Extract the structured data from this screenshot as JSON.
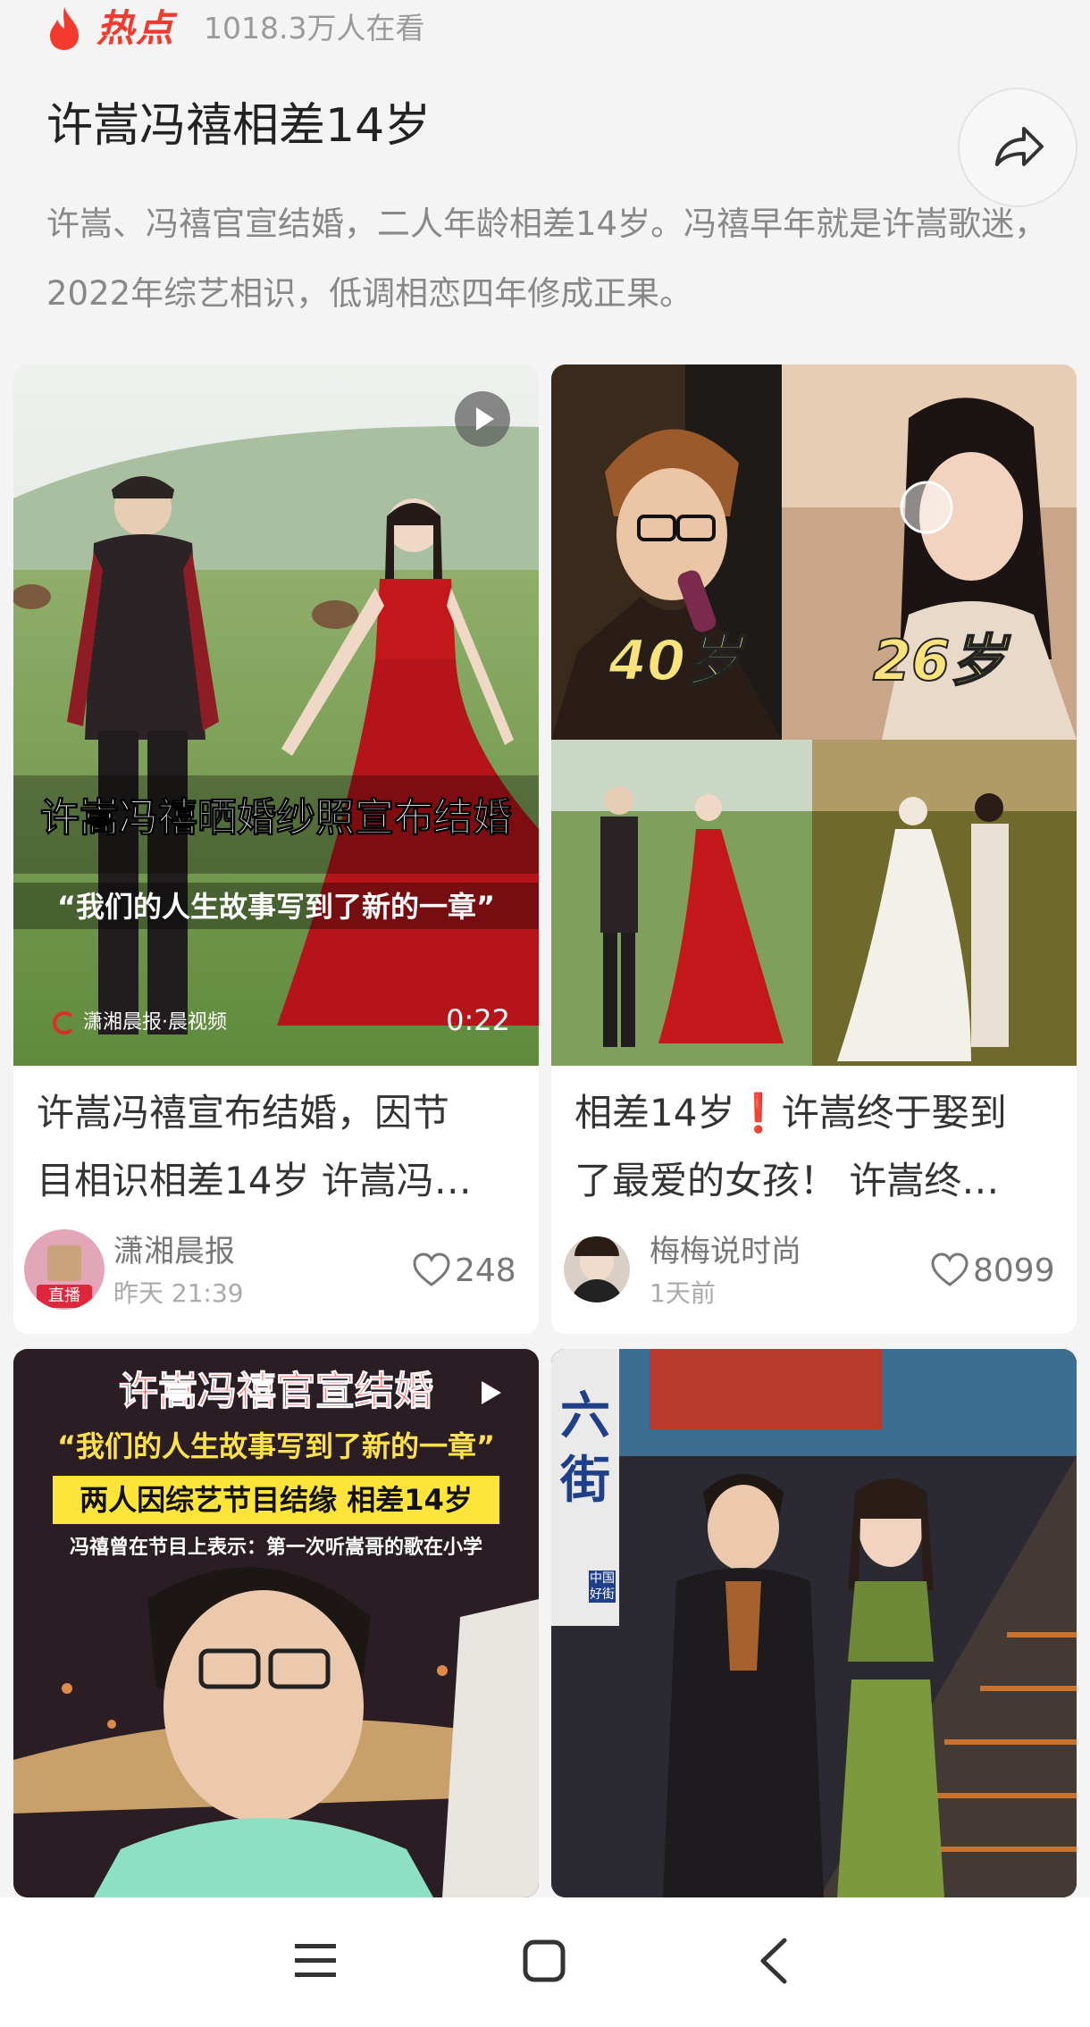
{
  "header": {
    "brand_label": "热点",
    "viewers": "1018.3万人在看",
    "title": "许嵩冯禧相差14岁",
    "description": "许嵩、冯禧官宣结婚，二人年龄相差14岁。冯禧早年就是许嵩歌迷，2022年综艺相识，低调相恋四年修成正果。"
  },
  "cards": [
    {
      "overlay_title": "许嵩冯禧晒婚纱照宣布结婚",
      "overlay_quote": "“我们的人生故事写到了新的一章”",
      "watermark": "潇湘晨报·晨视频",
      "duration": "0:22",
      "caption_line1": "许嵩冯禧宣布结婚，因节",
      "caption_line2": "目相识相差14岁 许嵩冯…",
      "author": "潇湘晨报",
      "avatar_badge": "直播",
      "time": "昨天 21:39",
      "likes": "248"
    },
    {
      "age_left": "40岁",
      "age_right": "26岁",
      "caption_line1": "相差14岁❗许嵩终于娶到",
      "caption_line2": "了最爱的女孩！ 许嵩终…",
      "author": "梅梅说时尚",
      "time": "1天前",
      "likes": "8099"
    },
    {
      "banner_title": "许嵩冯禧官宣结婚",
      "banner_quote": "“我们的人生故事写到了新的一章”",
      "banner_highlight": "两人因综艺节目结缘 相差14岁",
      "banner_sub": "冯禧曾在节目上表示：第一次听嵩哥的歌在小学"
    },
    {
      "sign_text": "六街",
      "sign_small": "中国好街"
    }
  ],
  "colors": {
    "accent": "#f23a2f",
    "background": "#f4f4f4"
  },
  "icons": [
    "flame-icon",
    "share-icon",
    "play-icon",
    "heart-icon",
    "menu-icon",
    "home-square-icon",
    "back-chevron-icon"
  ]
}
